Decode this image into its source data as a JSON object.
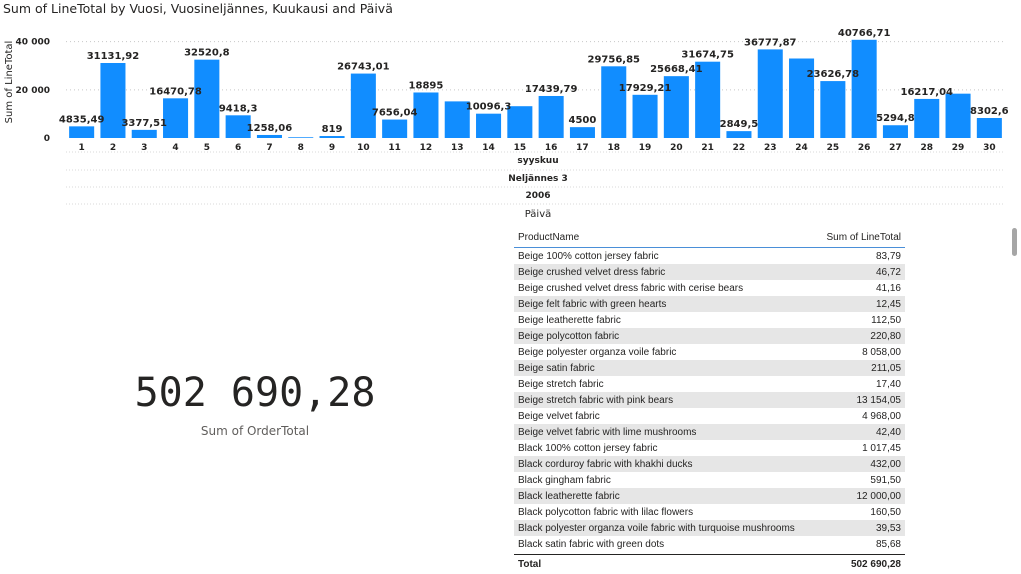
{
  "chart_data": {
    "type": "bar",
    "title": "Sum of LineTotal by Vuosi, Vuosineljännes, Kuukausi and Päivä",
    "ylabel": "Sum of LineTotal",
    "xlabel": "Päivä",
    "ylim": [
      0,
      44000
    ],
    "yticks": [
      "0",
      "20 000",
      "40 000"
    ],
    "ytick_values": [
      0,
      20000,
      40000
    ],
    "grid": true,
    "color": "#118dff",
    "categories": [
      "1",
      "2",
      "3",
      "4",
      "5",
      "6",
      "7",
      "8",
      "9",
      "10",
      "11",
      "12",
      "13",
      "14",
      "15",
      "16",
      "17",
      "18",
      "19",
      "20",
      "21",
      "22",
      "23",
      "24",
      "25",
      "26",
      "27",
      "28",
      "29",
      "30"
    ],
    "values": [
      4835.49,
      31131.92,
      3377.51,
      16470.78,
      32520.8,
      9418.3,
      1258.06,
      300,
      819,
      26743.01,
      7656.04,
      18895,
      15200,
      10096.3,
      13200,
      17439.79,
      4500,
      29756.85,
      17929.21,
      25668.41,
      31674.75,
      2849.5,
      36777.87,
      33000,
      23626.78,
      40766.71,
      5294.8,
      16217.04,
      18400,
      8302.6
    ],
    "data_labels": [
      "4835,49",
      "31131,92",
      "3377,51",
      "16470,78",
      "32520,8",
      "9418,3",
      "1258,06",
      "",
      "819",
      "26743,01",
      "7656,04",
      "18895",
      "",
      "10096,3",
      "",
      "17439,79",
      "4500",
      "29756,85",
      "17929,21",
      "25668,41",
      "31674,75",
      "2849,5",
      "36777,87",
      "",
      "23626,78",
      "40766,71",
      "5294,8",
      "16217,04",
      "",
      "8302,6"
    ],
    "hierarchy": {
      "month": "syyskuu",
      "quarter": "Neljännes 3",
      "year": "2006"
    }
  },
  "card": {
    "value": "502 690,28",
    "label": "Sum of OrderTotal"
  },
  "table": {
    "headers": {
      "name": "ProductName",
      "value": "Sum of LineTotal"
    },
    "rows": [
      {
        "name": "Beige 100% cotton jersey fabric",
        "value": "83,79"
      },
      {
        "name": "Beige crushed velvet dress fabric",
        "value": "46,72"
      },
      {
        "name": "Beige crushed velvet dress fabric with cerise bears",
        "value": "41,16"
      },
      {
        "name": "Beige felt fabric with green hearts",
        "value": "12,45"
      },
      {
        "name": "Beige leatherette fabric",
        "value": "112,50"
      },
      {
        "name": "Beige polycotton fabric",
        "value": "220,80"
      },
      {
        "name": "Beige polyester organza voile fabric",
        "value": "8 058,00"
      },
      {
        "name": "Beige satin fabric",
        "value": "211,05"
      },
      {
        "name": "Beige stretch fabric",
        "value": "17,40"
      },
      {
        "name": "Beige stretch fabric with pink bears",
        "value": "13 154,05"
      },
      {
        "name": "Beige velvet fabric",
        "value": "4 968,00"
      },
      {
        "name": "Beige velvet fabric with lime mushrooms",
        "value": "42,40"
      },
      {
        "name": "Black 100% cotton jersey fabric",
        "value": "1 017,45"
      },
      {
        "name": "Black corduroy fabric with khakhi ducks",
        "value": "432,00"
      },
      {
        "name": "Black gingham fabric",
        "value": "591,50"
      },
      {
        "name": "Black leatherette fabric",
        "value": "12 000,00"
      },
      {
        "name": "Black polycotton fabric with lilac flowers",
        "value": "160,50"
      },
      {
        "name": "Black polyester organza voile fabric with turquoise mushrooms",
        "value": "39,53"
      },
      {
        "name": "Black satin fabric with green dots",
        "value": "85,68"
      }
    ],
    "total": {
      "label": "Total",
      "value": "502 690,28"
    }
  }
}
